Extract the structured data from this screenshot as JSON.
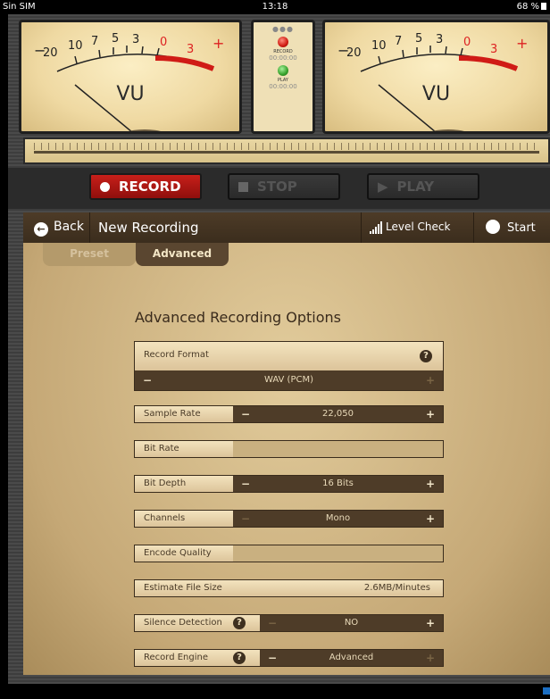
{
  "status": {
    "carrier": "Sin SIM",
    "time": "13:18",
    "battery": "68 %"
  },
  "meters": {
    "vu_label": "VU",
    "scale": [
      "20",
      "10",
      "7",
      "5",
      "3",
      "0",
      "3"
    ],
    "minus": "−",
    "plus": "+"
  },
  "center": {
    "dots": "●●●",
    "record_label": "RECORD",
    "record_time": "00:00:00",
    "play_label": "PLAY",
    "play_time": "00:00:00"
  },
  "transport": {
    "record": "RECORD",
    "stop": "STOP",
    "play": "PLAY"
  },
  "nav": {
    "back": "Back",
    "title": "New Recording",
    "level_check": "Level Check",
    "start": "Start"
  },
  "tabs": {
    "preset": "Preset",
    "advanced": "Advanced"
  },
  "section_title": "Advanced Recording Options",
  "options": {
    "record_format": {
      "label": "Record Format",
      "value": "WAV (PCM)"
    },
    "sample_rate": {
      "label": "Sample Rate",
      "value": "22,050"
    },
    "bit_rate": {
      "label": "Bit Rate"
    },
    "bit_depth": {
      "label": "Bit Depth",
      "value": "16 Bits"
    },
    "channels": {
      "label": "Channels",
      "value": "Mono"
    },
    "encode_quality": {
      "label": "Encode Quality"
    },
    "estimate_file_size": {
      "label": "Estimate File Size",
      "value": "2.6MB/Minutes"
    },
    "silence_detection": {
      "label": "Silence Detection",
      "value": "NO"
    },
    "record_engine": {
      "label": "Record Engine",
      "value": "Advanced"
    }
  },
  "symbols": {
    "minus": "−",
    "plus": "+",
    "help": "?"
  },
  "colors": {
    "record_red": "#c71f1a",
    "panel_brown": "#4e3c28",
    "beige": "#e2cc9c"
  }
}
